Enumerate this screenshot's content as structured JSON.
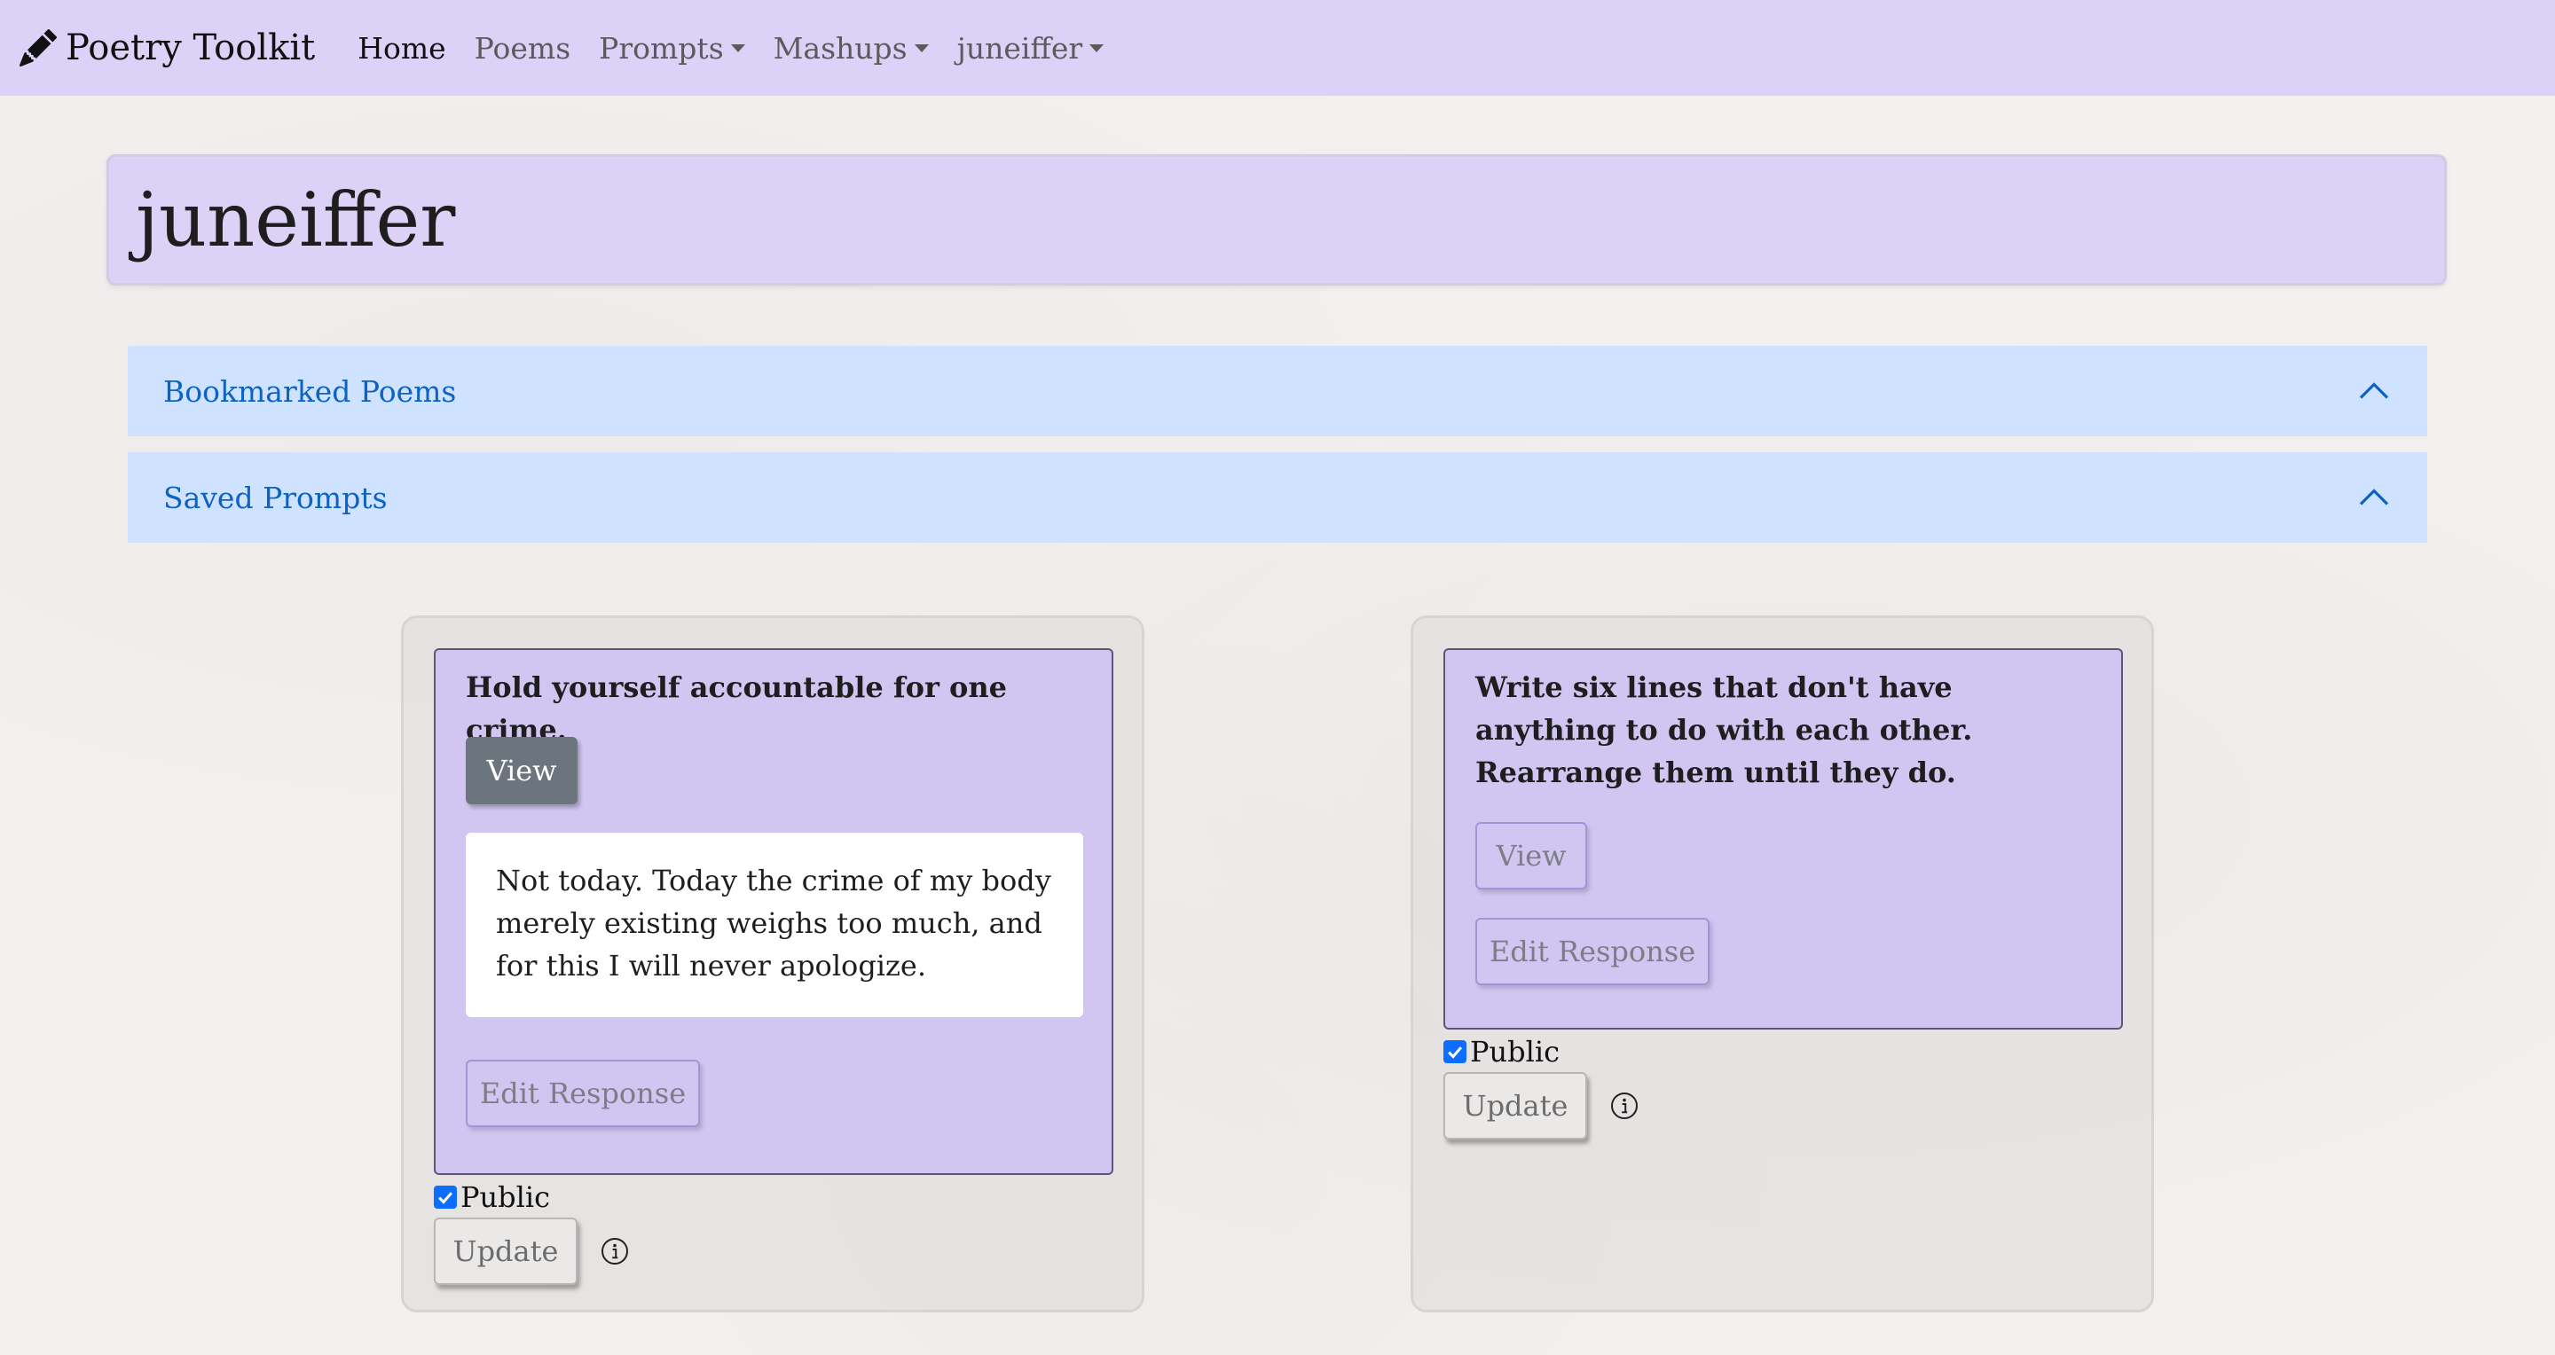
{
  "navbar": {
    "brand": "Poetry Toolkit",
    "brand_icon": "pencil-icon",
    "links": [
      {
        "label": "Home",
        "active": true,
        "dropdown": false
      },
      {
        "label": "Poems",
        "active": false,
        "dropdown": false
      },
      {
        "label": "Prompts",
        "active": false,
        "dropdown": true
      },
      {
        "label": "Mashups",
        "active": false,
        "dropdown": true
      },
      {
        "label": "juneiffer",
        "active": false,
        "dropdown": true
      }
    ]
  },
  "profile": {
    "username": "juneiffer"
  },
  "accordion": [
    {
      "label": "Bookmarked Poems",
      "icon": "chevron-up-icon"
    },
    {
      "label": "Saved Prompts",
      "icon": "chevron-up-icon"
    }
  ],
  "saved_prompts": [
    {
      "prompt": "Hold yourself accountable for one crime.",
      "view_label": "View",
      "response": "Not today. Today the crime of my body merely existing weighs too much, and for this I will never apologize.",
      "edit_label": "Edit Response",
      "public_label": "Public",
      "public_checked": true,
      "update_label": "Update",
      "info_icon": "info-icon"
    },
    {
      "prompt": "Write six lines that don't have anything to do with each other. Rearrange them until they do.",
      "view_label": "View",
      "response": "",
      "edit_label": "Edit Response",
      "public_label": "Public",
      "public_checked": true,
      "update_label": "Update",
      "info_icon": "info-icon"
    }
  ],
  "colors": {
    "navbar_bg": "#dcd2f7",
    "accordion_bg": "#cfe2ff",
    "accordion_text": "#0c63c4",
    "prompt_card_bg": "#d0c6f1",
    "checkbox": "#0d6efd"
  }
}
